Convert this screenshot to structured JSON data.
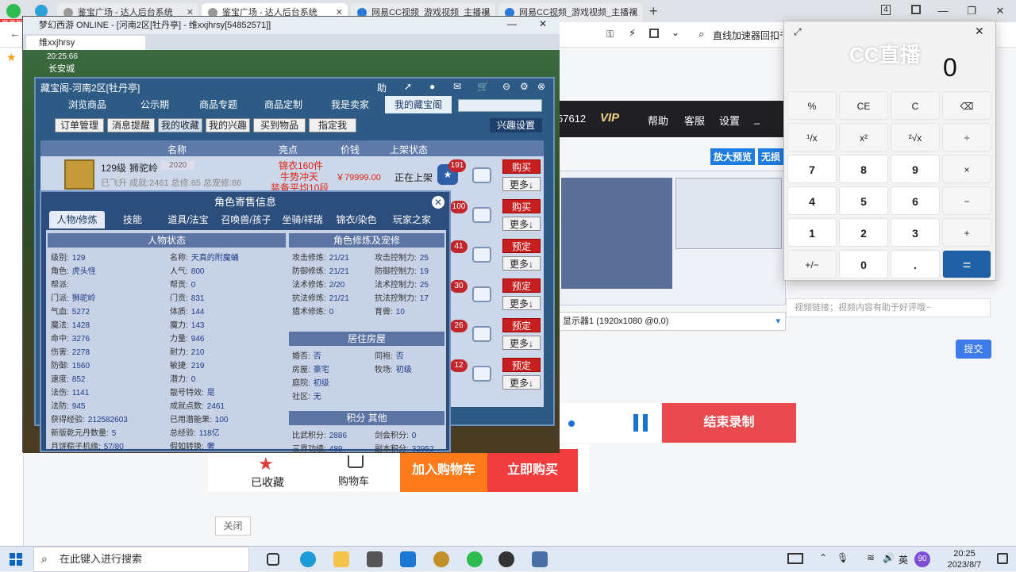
{
  "browser": {
    "tabs": [
      {
        "title": "鉴宝广场 - 达人后台系统"
      },
      {
        "title": "鉴宝广场 - 达人后台系统"
      },
      {
        "title": "网易CC视频_游戏视频_主播视"
      },
      {
        "title": "网易CC视频_游戏视频_主播视"
      }
    ],
    "new_tab": "+",
    "tab_count": "4",
    "search_text": "直线加速器回扣千万",
    "status_badge": "登录账"
  },
  "web": {
    "vip_num": "57612",
    "vip": "VIP",
    "menu": [
      "帮助",
      "客服",
      "设置"
    ],
    "blue_tags": [
      "放大预览",
      "无损"
    ],
    "display_select": "显示器1 (1920x1080 @0,0)",
    "comment_placeholder": "视频链接；视频内容有助于好评哦~",
    "submit": "提交",
    "end_record": "结束录制",
    "fav_label": "已收藏",
    "cart_label": "购物车",
    "add_cart": "加入购物车",
    "buy_now": "立即购买",
    "close": "关闭"
  },
  "game": {
    "title": "梦幻西游 ONLINE - [河南2区[牡丹亭] - 维xxjhrsy[54852571]]",
    "tab": "维xxjhrsy",
    "time": "20:25:66",
    "location": "长安城",
    "cangbao": {
      "title": "藏宝阁-河南2区[牡丹亭]",
      "top_icons": [
        "助"
      ],
      "nav": [
        "浏览商品",
        "公示期",
        "商品专题",
        "商品定制",
        "我是卖家",
        "我的藏宝阁"
      ],
      "sub": [
        "订单管理",
        "消息提醒",
        "我的收藏",
        "我的兴趣",
        "买到物品",
        "指定我"
      ],
      "interest_btn": "兴趣设置",
      "cols": [
        "名称",
        "亮点",
        "价钱",
        "上架状态"
      ],
      "row1": {
        "level": "129级",
        "school": "狮驼岭",
        "year": "2020",
        "meta": "已飞升 成就:2461 总修:65 总宠修:86",
        "hl1": "锦衣160件",
        "hl2": "牛势冲天",
        "hl3": "装备平均10段",
        "price": "￥79999.00",
        "status": "正在上架",
        "fav": "191"
      },
      "badges": [
        "100",
        "41",
        "30",
        "26",
        "12"
      ],
      "buy": "购买",
      "preorder": "预定",
      "more": "更多↓"
    },
    "role": {
      "title": "角色寄售信息",
      "tabs": [
        "人物/修炼",
        "技能",
        "道具/法宝",
        "召唤兽/孩子",
        "坐骑/祥瑞",
        "锦衣/染色",
        "玩家之家"
      ],
      "sec_status": "人物状态",
      "sec_cult": "角色修炼及宠修",
      "sec_house": "居住房屋",
      "sec_score": "积分 其他",
      "left": [
        [
          "级别:",
          "129"
        ],
        [
          "角色:",
          "虎头怪"
        ],
        [
          "帮派:",
          ""
        ],
        [
          "门派:",
          "狮驼岭"
        ],
        [
          "气血:",
          "5272"
        ],
        [
          "魔法:",
          "1428"
        ],
        [
          "命中:",
          "3276"
        ],
        [
          "伤害:",
          "2278"
        ],
        [
          "防御:",
          "1560"
        ],
        [
          "速度:",
          "852"
        ],
        [
          "法伤:",
          "1141"
        ],
        [
          "法防:",
          "945"
        ],
        [
          "获得经验:",
          "212582603"
        ],
        [
          "新版乾元丹数量:",
          "5"
        ],
        [
          "月饼粽子机缘:",
          "57/80"
        ]
      ],
      "mid": [
        [
          "名称:",
          "天真的附魔蛹"
        ],
        [
          "人气:",
          "800"
        ],
        [
          "帮贡:",
          "0"
        ],
        [
          "门贡:",
          "831"
        ],
        [
          "体质:",
          "144"
        ],
        [
          "魔力:",
          "143"
        ],
        [
          "力量:",
          "946"
        ],
        [
          "耐力:",
          "210"
        ],
        [
          "敏捷:",
          "219"
        ],
        [
          "潜力:",
          "0"
        ],
        [
          "靓号特效:",
          "是"
        ],
        [
          "成就点数:",
          "2461"
        ],
        [
          "已用潜能果:",
          "100"
        ],
        [
          "总经验:",
          "118亿"
        ],
        [
          "假如转换:",
          "奢"
        ]
      ],
      "cult": [
        [
          "攻击修炼:",
          "21/21",
          "攻击控制力:",
          "25"
        ],
        [
          "防御修炼:",
          "21/21",
          "防御控制力:",
          "19"
        ],
        [
          "法术修炼:",
          "2/20",
          "法术控制力:",
          "25"
        ],
        [
          "抗法修炼:",
          "21/21",
          "抗法控制力:",
          "17"
        ],
        [
          "猎术修炼:",
          "0",
          "育兽:",
          "10"
        ]
      ],
      "house": [
        [
          "婚否:",
          "否",
          "同袍:",
          "否"
        ],
        [
          "房屋:",
          "豪宅",
          "牧场:",
          "初级"
        ],
        [
          "庭院:",
          "初级",
          "",
          ""
        ],
        [
          "社区:",
          "无",
          "",
          ""
        ]
      ],
      "score": [
        [
          "比武积分:",
          "2886",
          "剑会积分:",
          "0"
        ],
        [
          "三界功绩:",
          "489",
          "副本积分:",
          "32952"
        ]
      ]
    }
  },
  "calc": {
    "display": "0",
    "logo": "CC直播",
    "keys": [
      "%",
      "CE",
      "C",
      "⌫",
      "¹/x",
      "x²",
      "²√x",
      "÷",
      "7",
      "8",
      "9",
      "×",
      "4",
      "5",
      "6",
      "−",
      "1",
      "2",
      "3",
      "+",
      "+/−",
      "0",
      ".",
      "="
    ]
  },
  "taskbar": {
    "search": "在此键入进行搜索",
    "time": "20:25",
    "date": "2023/8/7",
    "ime": "英",
    "notif": "90"
  }
}
